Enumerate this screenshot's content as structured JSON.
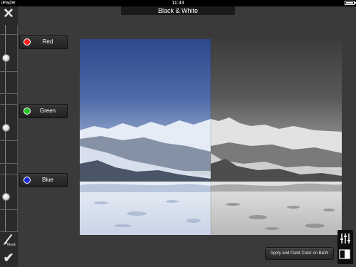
{
  "status": {
    "carrier": "iPad",
    "time": "11:43"
  },
  "title": "Black & White",
  "icons": {
    "close": "close-icon",
    "wifi": "wifi-icon",
    "battery": "battery-icon",
    "brush": "brush-icon",
    "check": "check-icon",
    "sliders": "sliders-icon",
    "compare": "compare-icon"
  },
  "channels": [
    {
      "label": "Red",
      "color": "#ff2020"
    },
    {
      "label": "Green",
      "color": "#27c227"
    },
    {
      "label": "Blue",
      "color": "#1d2cd8"
    }
  ],
  "mask_label": "Mask",
  "apply_button": "Apply and Paint Color on B&W",
  "colors": {
    "background": "#3a3a3a",
    "panel": "#2a2a2a"
  }
}
